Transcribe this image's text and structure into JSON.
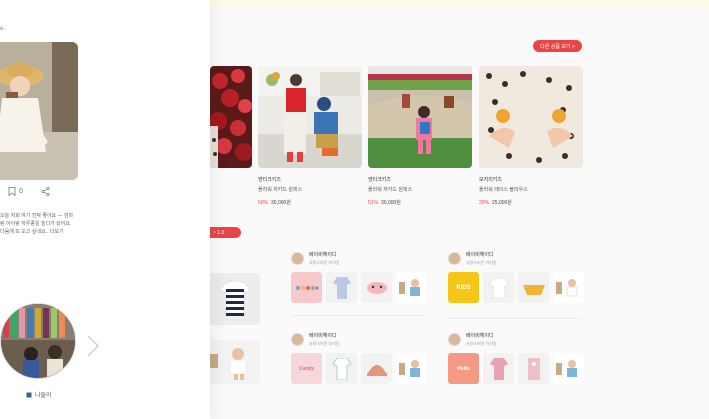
{
  "left_panel": {
    "top_text": "e.",
    "save_count": "0",
    "description": "오늘 저희 여기 진짜 좋아요 — 엄마랑 아이랑 하루종일 놀다가 왔어요. 다음에 또 오고 싶네요.. 더보기",
    "caption": "나들이"
  },
  "more_button": "다른 상품 보기 >",
  "products": [
    {
      "brand": "",
      "name": "",
      "price": "",
      "discount": ""
    },
    {
      "brand": "엔티크키즈",
      "name": "플라워 자카드 원피스",
      "discount": "50%",
      "price": "30,000원"
    },
    {
      "brand": "엔티크키즈",
      "name": "플라워 자카드 원피스",
      "discount": "51%",
      "price": "30,000원"
    },
    {
      "brand": "모지리키즈",
      "name": "플라워 레이스 블라우스",
      "discount": "20%",
      "price": "25,000원"
    }
  ],
  "section_tag": "~ 1.0",
  "sellers": [
    {
      "name": "베이비헤이디",
      "sub": "사랑스러운 아기옷",
      "items": [
        "",
        "",
        "",
        ""
      ]
    },
    {
      "name": "베이비헤이디",
      "sub": "사랑스러운 아기옷",
      "items": [
        "KIDS",
        "",
        "",
        ""
      ]
    },
    {
      "name": "베이비헤이디",
      "sub": "사랑스러운 아기옷",
      "items": [
        "Candy",
        "",
        "",
        ""
      ]
    },
    {
      "name": "베이비헤이디",
      "sub": "사랑스러운 아기옷",
      "items": [
        "Hello",
        "",
        "",
        ""
      ]
    }
  ],
  "colors": {
    "accent": "#e94548"
  }
}
